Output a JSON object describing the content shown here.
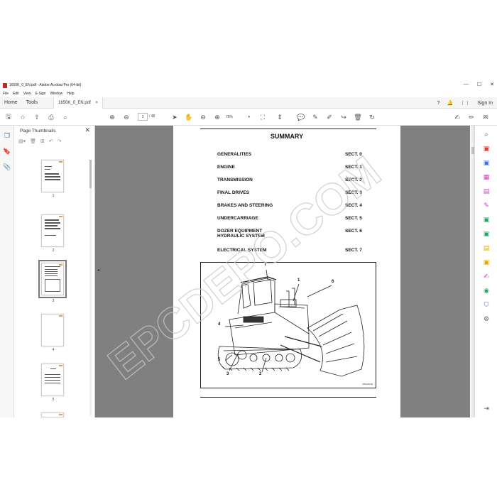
{
  "window": {
    "title": "1650K_0_EN.pdf - Adobe Acrobat Pro (64-bit)",
    "controls": [
      "—",
      "☐",
      "✕"
    ]
  },
  "menu": [
    "File",
    "Edit",
    "View",
    "E-Sign",
    "Window",
    "Help"
  ],
  "tabs": {
    "home": "Home",
    "tools": "Tools",
    "document": "1650K_0_EN.pdf",
    "doc_close": "×",
    "sign_in": "Sign In"
  },
  "toolbar": {
    "current_page": "3",
    "page_count": "/ 48",
    "zoom": "75%",
    "zoom_caret": "▾"
  },
  "thumbnails": {
    "header": "Page Thumbnails",
    "close": "✕",
    "pages": [
      "1",
      "2",
      "3",
      "4",
      "5"
    ]
  },
  "document": {
    "heading": "SUMMARY",
    "toc": [
      {
        "title": "GENERALITIES",
        "section": "SECT. 0"
      },
      {
        "title": "ENGINE",
        "section": "SECT. 1"
      },
      {
        "title": "TRANSMISSION",
        "section": "SECT. 2"
      },
      {
        "title": "FINAL DRIVES",
        "section": "SECT. 3"
      },
      {
        "title": "BRAKES AND STEERING",
        "section": "SECT. 4"
      },
      {
        "title": "UNDERCARRIAGE",
        "section": "SECT. 5"
      },
      {
        "title": "DOZER EQUIPMENT",
        "title2": "HYDRAULIC SYSTEM",
        "section": "SECT. 6"
      },
      {
        "title": "ELECTRICAL SYSTEM",
        "section": "SECT. 7"
      }
    ],
    "figure": {
      "callouts": [
        "7",
        "1",
        "6",
        "4",
        "5",
        "3",
        "2"
      ],
      "code": "M5L0601E"
    },
    "watermark": "EPCDEPO.COM"
  },
  "colors": {
    "accent": "#1473e6",
    "doc_bg": "#808080",
    "watermark": "#c8c8c8"
  }
}
